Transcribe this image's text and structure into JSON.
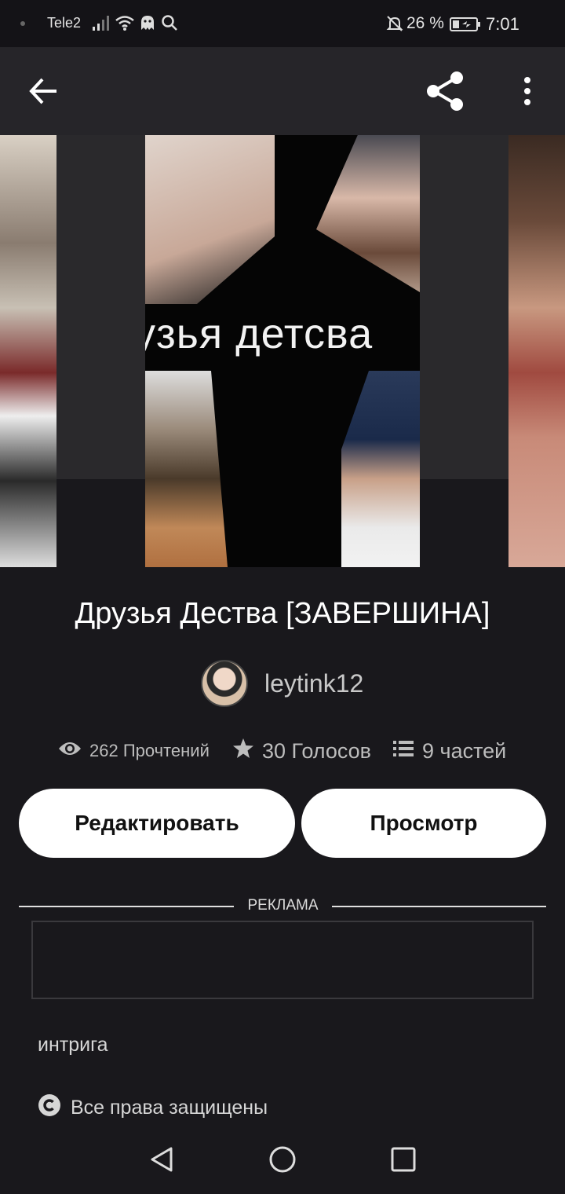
{
  "status_bar": {
    "carrier": "Tele2",
    "battery_percent": "26 %",
    "time": "7:01",
    "icons": [
      "signal-icon",
      "wifi-icon",
      "ghost-icon",
      "search-icon",
      "bell-off-icon",
      "battery-icon"
    ]
  },
  "app_bar": {
    "icons": [
      "back-arrow-icon",
      "share-icon",
      "more-vert-icon"
    ]
  },
  "cover": {
    "title_text": "узья детсва"
  },
  "story": {
    "title": "Друзья Дества [ЗАВЕРШИНА]",
    "author": "leytink12"
  },
  "stats": {
    "reads": "262 Прочтений",
    "votes": "30 Голосов",
    "parts": "9 частей"
  },
  "actions": {
    "edit": "Редактировать",
    "view": "Просмотр"
  },
  "ad": {
    "label": "РЕКЛАМА"
  },
  "tags": "интрига",
  "rights": "Все права защищены",
  "colors": {
    "background": "#19181c",
    "app_bar": "#262529",
    "button": "#ffffff",
    "text_secondary": "#bdbdbd"
  }
}
